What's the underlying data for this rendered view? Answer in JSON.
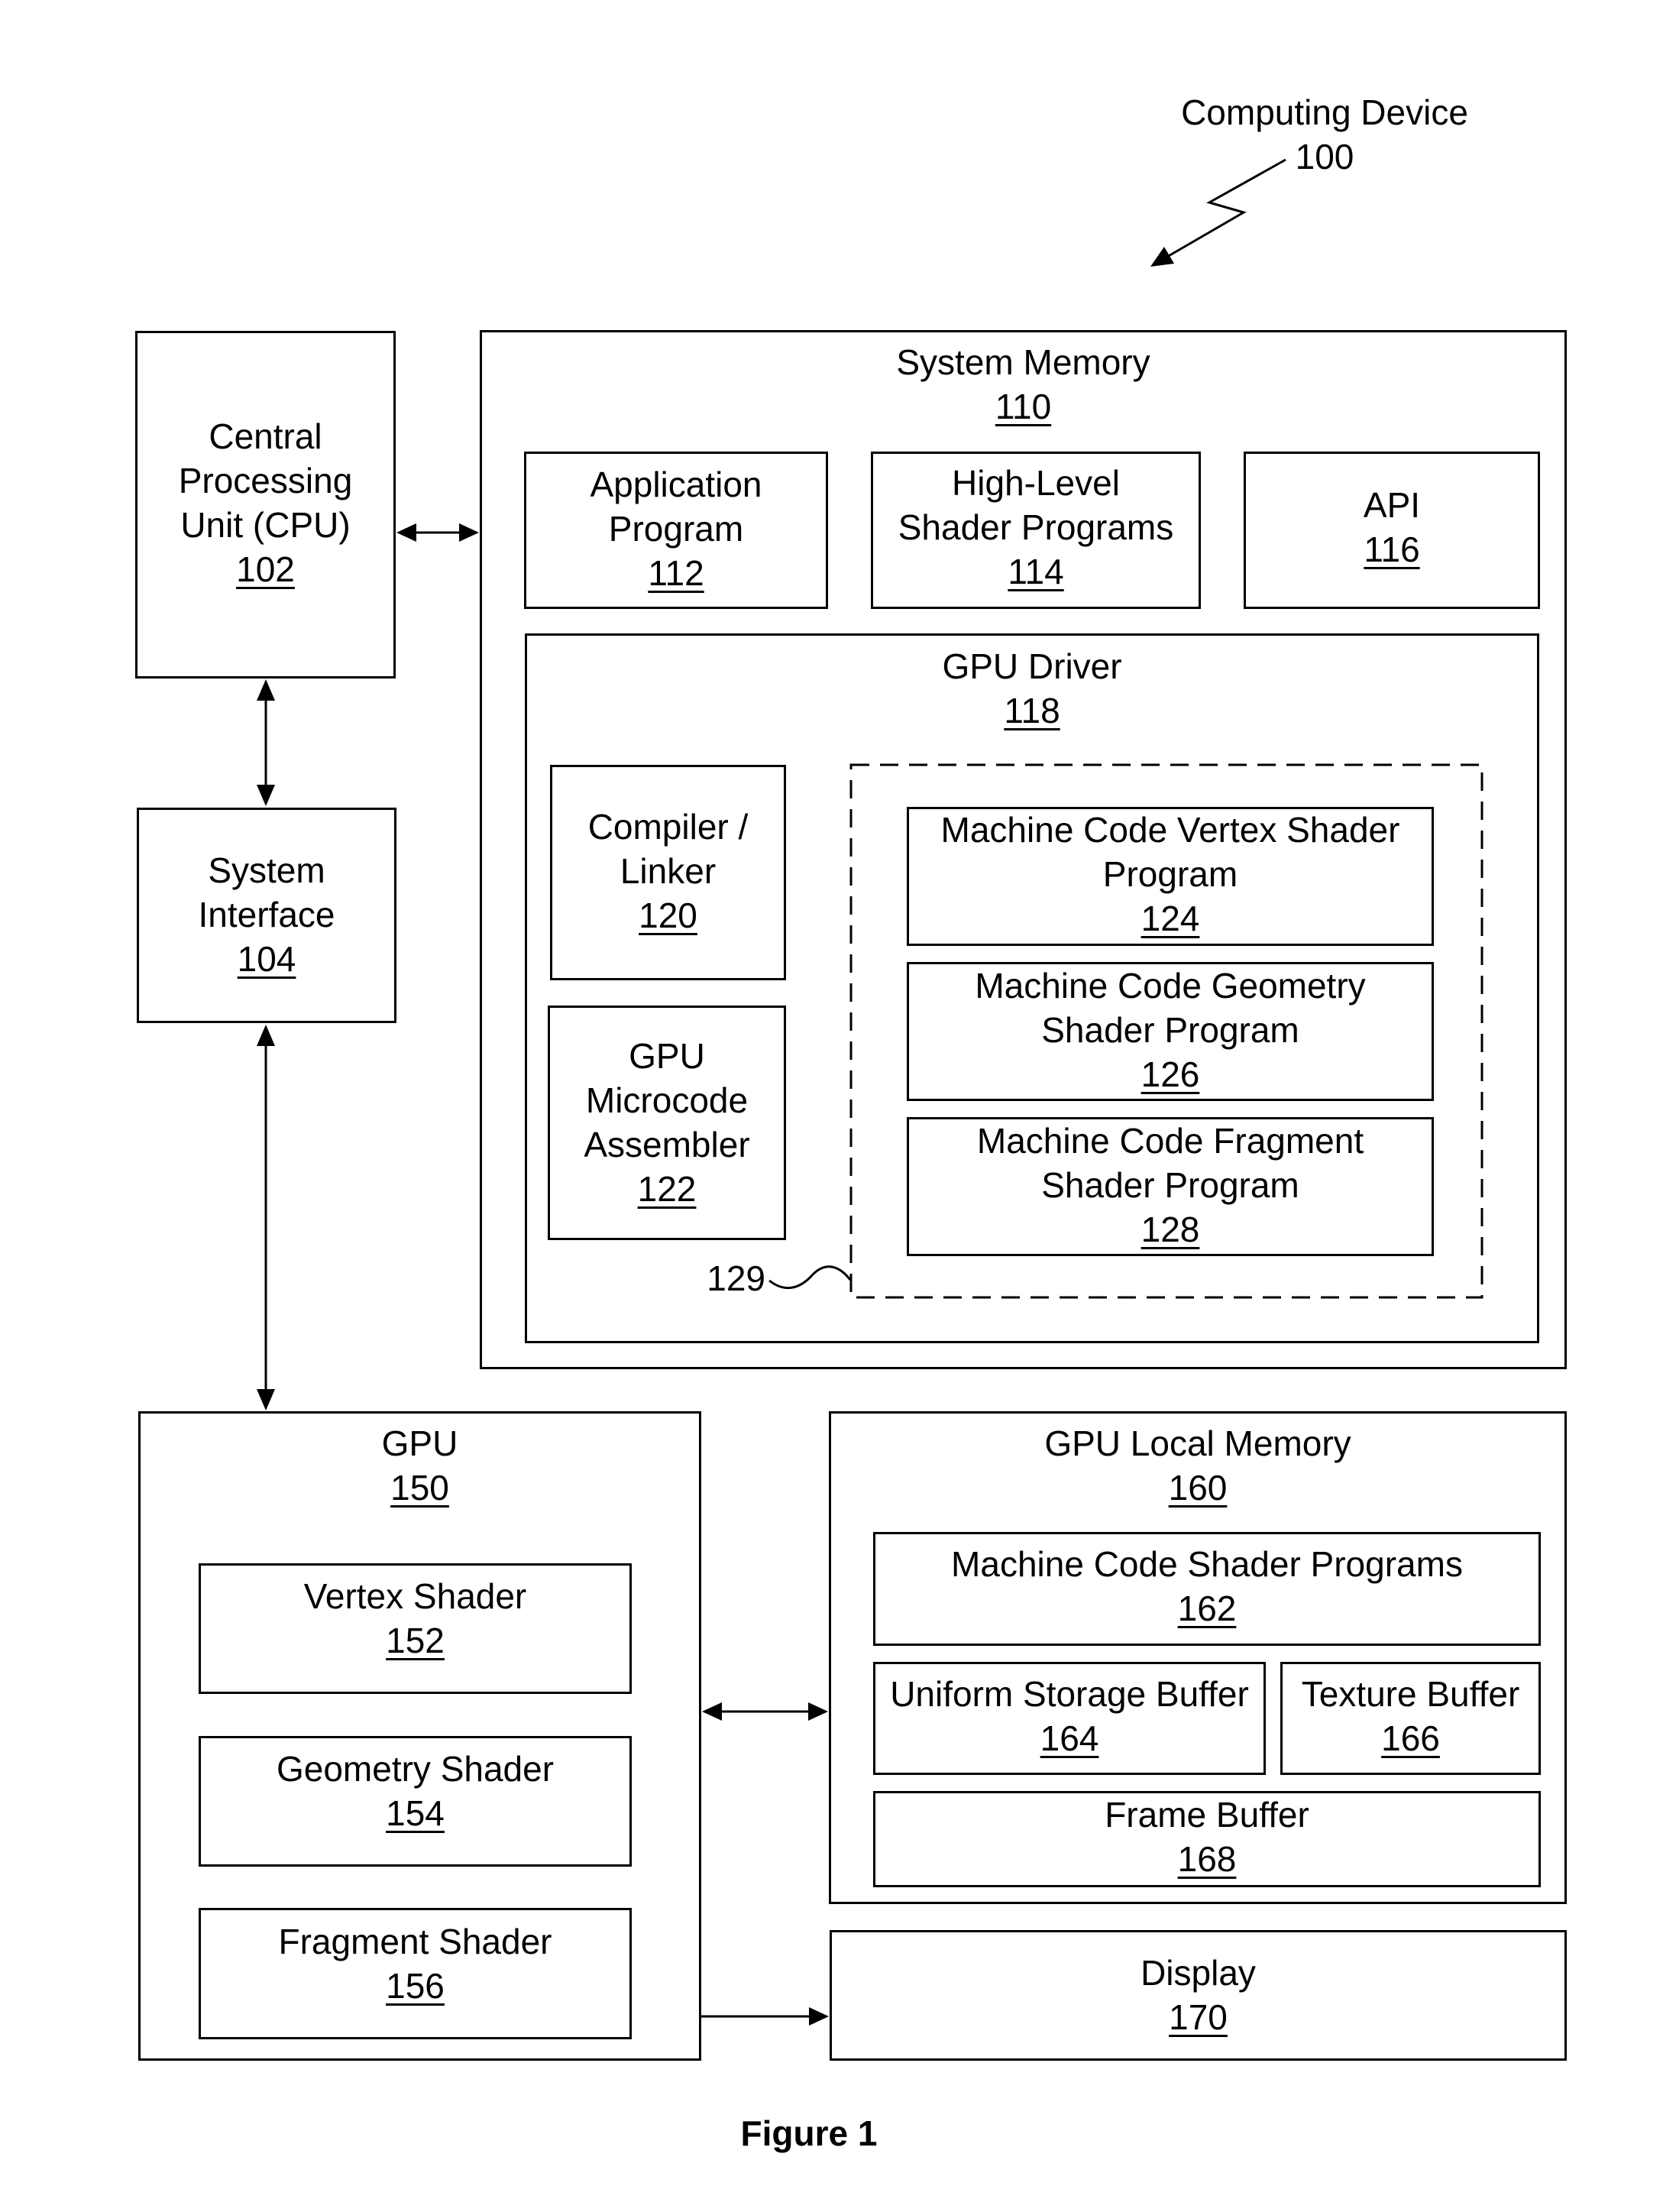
{
  "figure": {
    "device_title": "Computing Device",
    "device_ref": "100",
    "caption": "Figure 1",
    "dashed_group_ref": "129"
  },
  "cpu": {
    "lines": [
      "Central",
      "Processing",
      "Unit (CPU)"
    ],
    "ref": "102"
  },
  "system_interface": {
    "lines": [
      "System",
      "Interface"
    ],
    "ref": "104"
  },
  "system_memory": {
    "title": "System Memory",
    "ref": "110",
    "application_program": {
      "lines": [
        "Application",
        "Program"
      ],
      "ref": "112"
    },
    "high_level_shader_programs": {
      "lines": [
        "High-Level",
        "Shader Programs"
      ],
      "ref": "114"
    },
    "api": {
      "lines": [
        "API"
      ],
      "ref": "116"
    },
    "gpu_driver": {
      "title": "GPU Driver",
      "ref": "118",
      "compiler_linker": {
        "lines": [
          "Compiler /",
          "Linker"
        ],
        "ref": "120"
      },
      "gpu_microcode_assembler": {
        "lines": [
          "GPU",
          "Microcode",
          "Assembler"
        ],
        "ref": "122"
      },
      "machine_code_vertex_shader_program": {
        "lines": [
          "Machine Code Vertex Shader",
          "Program"
        ],
        "ref": "124"
      },
      "machine_code_geometry_shader_program": {
        "lines": [
          "Machine Code Geometry",
          "Shader Program"
        ],
        "ref": "126"
      },
      "machine_code_fragment_shader_program": {
        "lines": [
          "Machine Code Fragment",
          "Shader Program"
        ],
        "ref": "128"
      }
    }
  },
  "gpu": {
    "title": "GPU",
    "ref": "150",
    "vertex_shader": {
      "lines": [
        "Vertex Shader"
      ],
      "ref": "152"
    },
    "geometry_shader": {
      "lines": [
        "Geometry Shader"
      ],
      "ref": "154"
    },
    "fragment_shader": {
      "lines": [
        "Fragment Shader"
      ],
      "ref": "156"
    }
  },
  "gpu_local_memory": {
    "title": "GPU Local Memory",
    "ref": "160",
    "machine_code_shader_programs": {
      "lines": [
        "Machine Code Shader Programs"
      ],
      "ref": "162"
    },
    "uniform_storage_buffer": {
      "lines": [
        "Uniform Storage Buffer"
      ],
      "ref": "164"
    },
    "texture_buffer": {
      "lines": [
        "Texture Buffer"
      ],
      "ref": "166"
    },
    "frame_buffer": {
      "lines": [
        "Frame Buffer"
      ],
      "ref": "168"
    }
  },
  "display": {
    "lines": [
      "Display"
    ],
    "ref": "170"
  },
  "colors": {
    "line": "#000000",
    "background": "#ffffff"
  }
}
